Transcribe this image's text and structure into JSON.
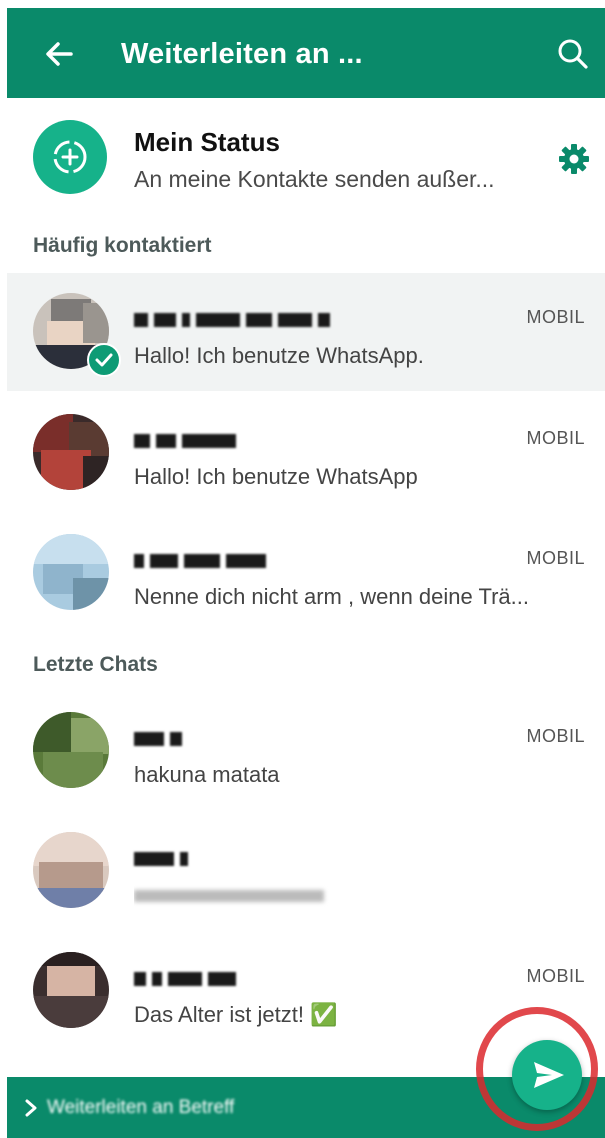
{
  "header": {
    "title": "Weiterleiten an ...",
    "back_icon": "arrow-left-icon",
    "search_icon": "search-icon",
    "color": "#0a8a6a"
  },
  "status": {
    "name": "Mein Status",
    "subtitle": "An meine Kontakte senden außer...",
    "icon": "status-add-icon",
    "settings_icon": "gear-icon"
  },
  "sections": {
    "frequent": "Häufig kontaktiert",
    "recent": "Letzte Chats"
  },
  "frequent_contacts": [
    {
      "preview": "Hallo! Ich benutze WhatsApp.",
      "tag": "MOBIL",
      "selected": true
    },
    {
      "preview": "Hallo! Ich benutze WhatsApp",
      "tag": "MOBIL",
      "selected": false
    },
    {
      "preview": "Nenne dich nicht arm , wenn deine Trä...",
      "tag": "MOBIL",
      "selected": false
    }
  ],
  "recent_chats": [
    {
      "preview": "hakuna matata",
      "tag": "MOBIL"
    },
    {
      "preview": "",
      "tag": ""
    },
    {
      "preview": "Das Alter ist jetzt! ✅",
      "tag": "MOBIL"
    }
  ],
  "bottom_bar": {
    "text": "Weiterleiten an Betreff",
    "chevron_icon": "chevron-right-icon"
  },
  "fab": {
    "icon": "send-icon",
    "color": "#16b28a"
  }
}
